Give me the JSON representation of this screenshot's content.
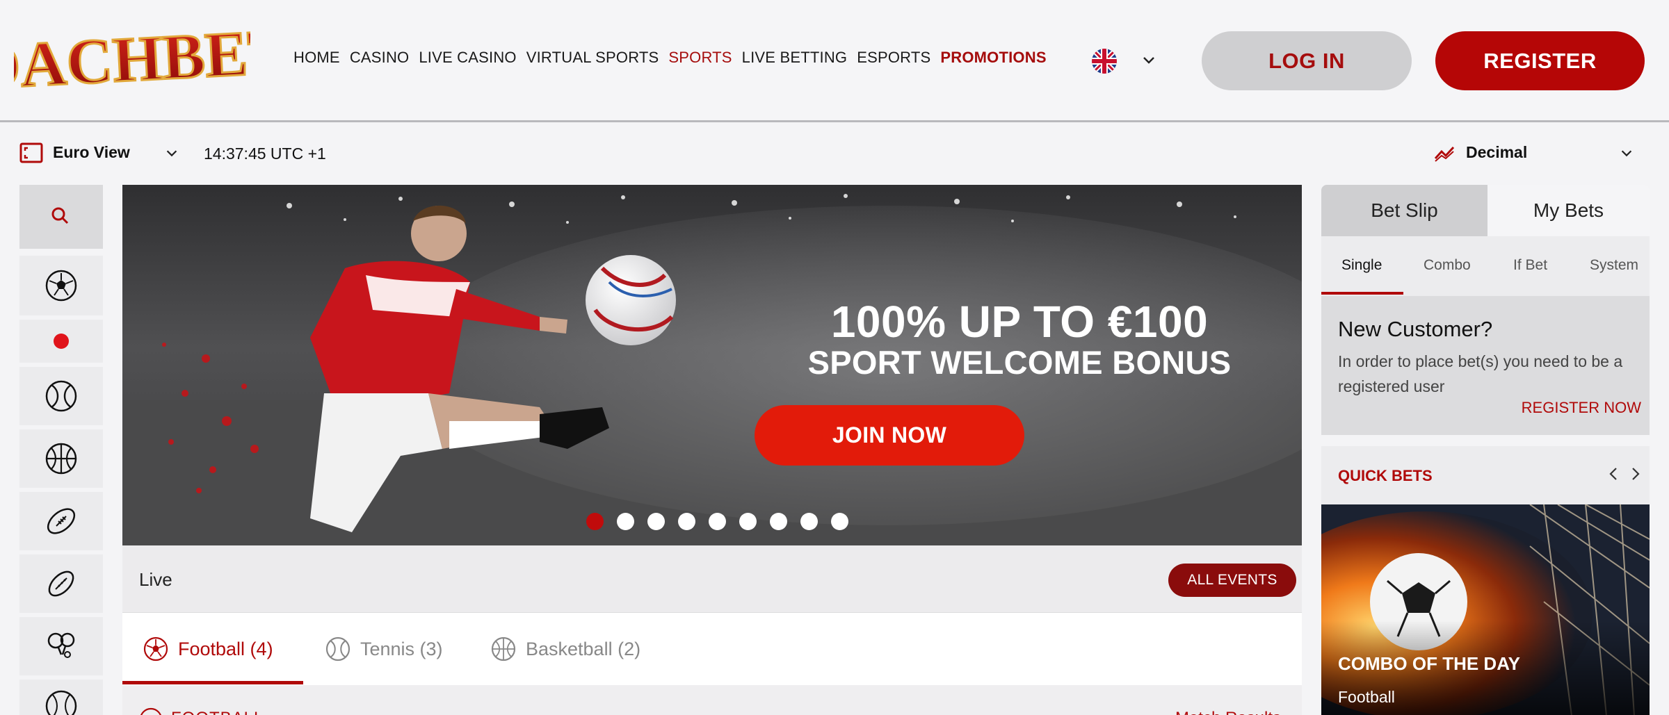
{
  "brand": {
    "logo_text": "DACHBET"
  },
  "nav": {
    "items": [
      {
        "label": "HOME"
      },
      {
        "label": "CASINO"
      },
      {
        "label": "LIVE CASINO"
      },
      {
        "label": "VIRTUAL SPORTS"
      },
      {
        "label": "SPORTS"
      },
      {
        "label": "LIVE BETTING"
      },
      {
        "label": "ESPORTS"
      },
      {
        "label": "PROMOTIONS"
      }
    ],
    "active": "SPORTS",
    "highlight": "PROMOTIONS"
  },
  "header": {
    "language_icon": "uk-flag-icon",
    "login_label": "LOG IN",
    "register_label": "REGISTER"
  },
  "subbar": {
    "view_label": "Euro View",
    "clock": "14:37:45 UTC +1",
    "odds_format": "Decimal"
  },
  "rail": {
    "icons": [
      "search-icon",
      "football-icon",
      "live-dot-icon",
      "tennis-icon",
      "basketball-icon",
      "american-football-icon",
      "rugby-icon",
      "table-tennis-icon",
      "baseball-icon"
    ]
  },
  "hero": {
    "headline": "100% UP TO €100",
    "subheadline": "SPORT WELCOME BONUS",
    "cta": "JOIN NOW",
    "slide_count": 9,
    "active_slide": 1
  },
  "live": {
    "label": "Live",
    "all_events": "ALL EVENTS",
    "tabs": [
      {
        "label": "Football (4)",
        "icon": "football-icon"
      },
      {
        "label": "Tennis (3)",
        "icon": "tennis-icon"
      },
      {
        "label": "Basketball (2)",
        "icon": "basketball-icon"
      }
    ],
    "section_label": "FOOTBALL",
    "results_link": "Match Results"
  },
  "betslip": {
    "tab_betslip": "Bet Slip",
    "tab_mybets": "My Bets",
    "types": [
      "Single",
      "Combo",
      "If Bet",
      "System"
    ],
    "new_customer_title": "New Customer?",
    "new_customer_text": "In order to place bet(s) you need to be a registered user",
    "register_now": "REGISTER NOW"
  },
  "quick_bets": {
    "title": "QUICK BETS",
    "card_title": "COMBO OF THE DAY",
    "card_sub": "Football"
  },
  "colors": {
    "brand_red": "#b50606",
    "accent_red": "#e21b0a",
    "dark_red": "#8a0c0c"
  }
}
